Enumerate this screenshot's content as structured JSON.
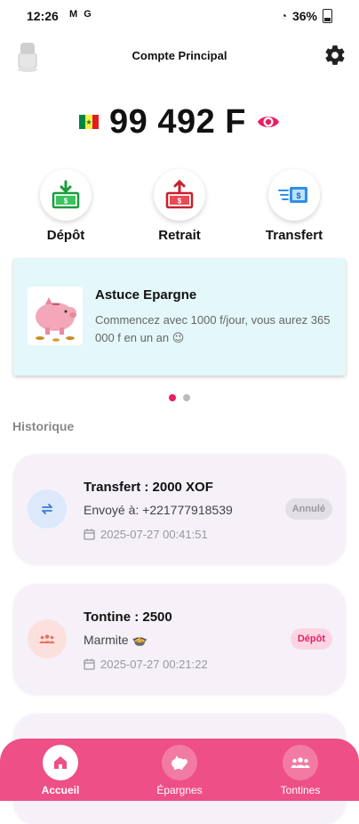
{
  "status_bar": {
    "time": "12:26",
    "left_icons": "M G",
    "battery": "36%"
  },
  "header": {
    "title": "Compte Principal"
  },
  "balance": {
    "amount": "99 492 F"
  },
  "actions": [
    {
      "label": "Dépôt",
      "icon": "deposit-icon"
    },
    {
      "label": "Retrait",
      "icon": "withdraw-icon"
    },
    {
      "label": "Transfert",
      "icon": "transfer-icon"
    }
  ],
  "banner": {
    "title": "Astuce Epargne",
    "text": "Commencez avec 1000 f/jour, vous aurez 365 000 f en un an 😉"
  },
  "carousel": {
    "count": 2,
    "active": 0
  },
  "history": {
    "title": "Historique",
    "items": [
      {
        "title": "Transfert : 2000 XOF",
        "subtitle": "Envoyé à: +221777918539",
        "date": "2025-07-27 00:41:51",
        "badge": "Annulé",
        "badge_bg": "#e3e0e5",
        "badge_fg": "#9a979c",
        "icon_bg": "#dbe9fb",
        "icon_color": "#3a7bd5"
      },
      {
        "title": "Tontine : 2500",
        "subtitle": "Marmite 🍲",
        "date": "2025-07-27 00:21:22",
        "badge": "Dépôt",
        "badge_bg": "#fbd6e2",
        "badge_fg": "#e91e63",
        "icon_bg": "#fbe0dd",
        "icon_color": "#e8735f"
      }
    ]
  },
  "nav": {
    "items": [
      {
        "label": "Accueil",
        "active": true
      },
      {
        "label": "Épargnes",
        "active": false
      },
      {
        "label": "Tontines",
        "active": false
      }
    ]
  },
  "colors": {
    "accent": "#e91e63",
    "nav_bg": "#ee4f86"
  }
}
